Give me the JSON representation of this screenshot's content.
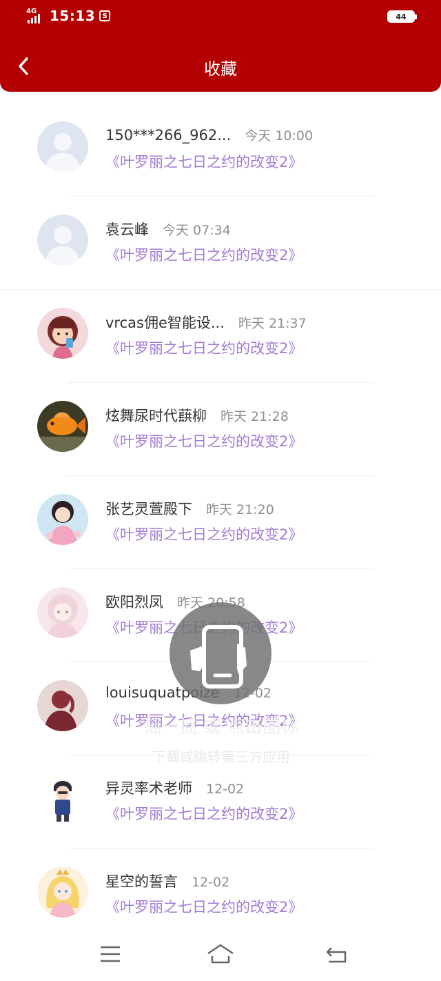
{
  "status_bar": {
    "network": "4G",
    "time": "15:13",
    "sim_icon": "sim-icon",
    "battery": "44"
  },
  "header": {
    "title": "收藏",
    "back_icon": "chevron-left-icon",
    "background": "#b30000"
  },
  "favorites": [
    {
      "name": "150***266_962...",
      "time": "今天 10:00",
      "book": "《叶罗丽之七日之约的改变2》",
      "avatar": "default-avatar"
    },
    {
      "name": "袁云峰",
      "time": "今天 07:34",
      "book": "《叶罗丽之七日之约的改变2》",
      "avatar": "default-avatar"
    },
    {
      "name": "vrcas佣e智能设...",
      "time": "昨天 21:37",
      "book": "《叶罗丽之七日之约的改变2》",
      "avatar": "girl-avatar"
    },
    {
      "name": "炫舞尿时代蕻柳",
      "time": "昨天 21:28",
      "book": "《叶罗丽之七日之约的改变2》",
      "avatar": "fish-avatar"
    },
    {
      "name": "张艺灵萱殿下",
      "time": "昨天 21:20",
      "book": "《叶罗丽之七日之约的改变2》",
      "avatar": "photo-avatar"
    },
    {
      "name": "欧阳烈凤",
      "time": "昨天 20:58",
      "book": "《叶罗丽之七日之约的改变2》",
      "avatar": "anime-avatar"
    },
    {
      "name": "louisuquatpoize",
      "time": "12-02",
      "book": "《叶罗丽之七日之约的改变2》",
      "avatar": "silhouette-avatar"
    },
    {
      "name": "异灵率术老师",
      "time": "12-02",
      "book": "《叶罗丽之七日之约的改变2》",
      "avatar": "cartoon-avatar"
    },
    {
      "name": "星空的誓言",
      "time": "12-02",
      "book": "《叶罗丽之七日之约的改变2》",
      "avatar": "anime-avatar"
    }
  ],
  "overlay": {
    "icon": "phone-hand-icon",
    "hint_line1": "摇一摇 或 点击图标",
    "hint_line2": "下载或跳转第三方应用"
  },
  "nav_bar": {
    "menu_icon": "menu-icon",
    "home_icon": "home-icon",
    "back_icon": "back-icon"
  },
  "colors": {
    "accent": "#b30000",
    "book_title": "#a47ad6",
    "time": "#8e8e8e"
  }
}
